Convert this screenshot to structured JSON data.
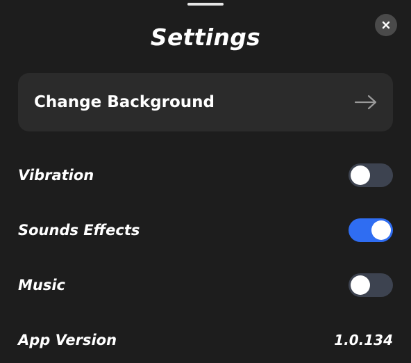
{
  "header": {
    "title": "Settings",
    "close_icon": "close-icon"
  },
  "background_option": {
    "label": "Change Background",
    "icon": "arrow-right-icon"
  },
  "settings": {
    "vibration": {
      "label": "Vibration",
      "enabled": false
    },
    "sound_effects": {
      "label": "Sounds Effects",
      "enabled": true
    },
    "music": {
      "label": "Music",
      "enabled": false
    }
  },
  "app_version": {
    "label": "App Version",
    "value": "1.0.134"
  },
  "colors": {
    "background": "#1d1d1d",
    "card": "#2b2b2b",
    "toggle_on": "#2f6df2",
    "toggle_off": "#3d4350",
    "text": "#ffffff"
  }
}
